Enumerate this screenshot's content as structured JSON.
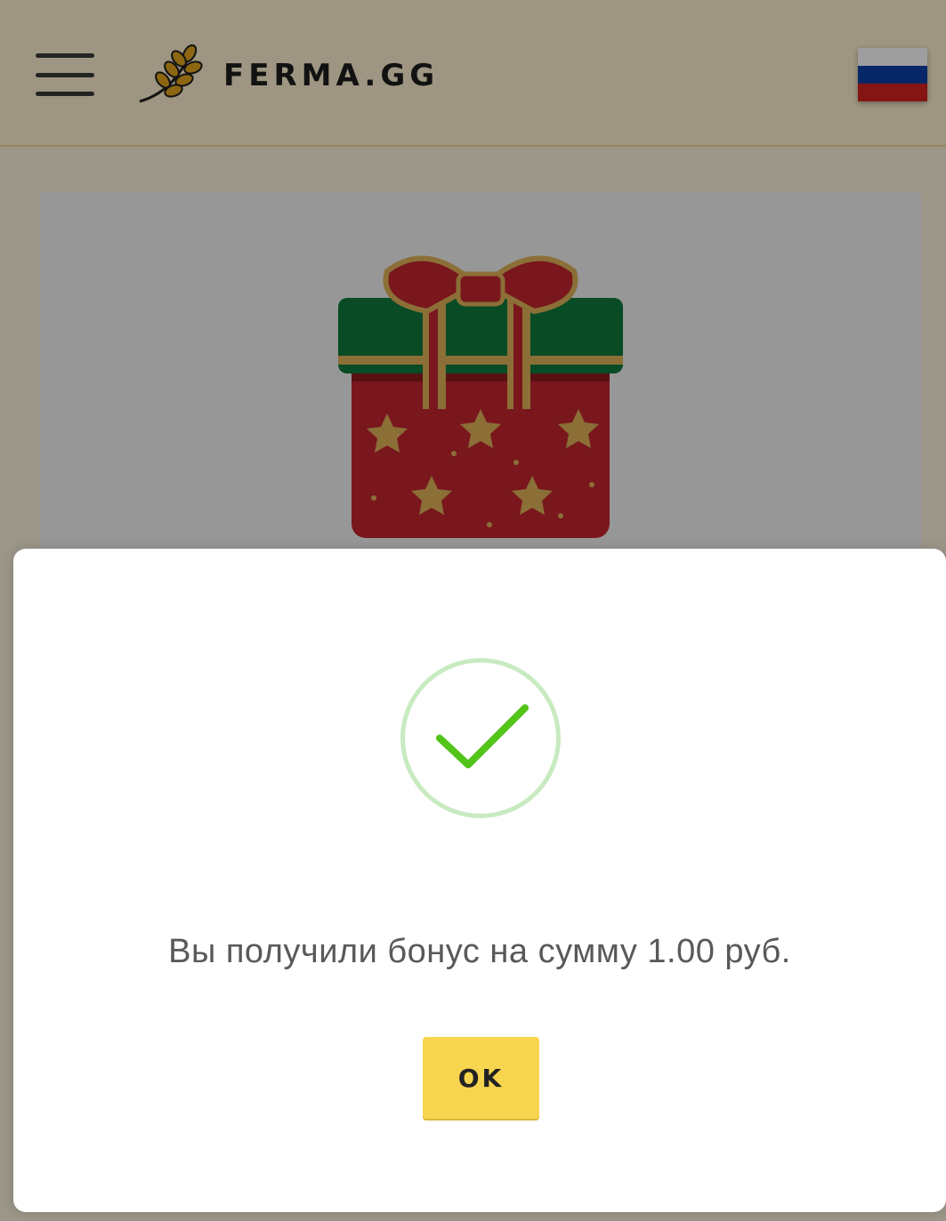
{
  "header": {
    "brand": "FERMA.GG",
    "menu_icon": "hamburger-menu-icon",
    "logo_icon": "wheat-icon",
    "language_flag": "russia-flag-icon",
    "flag_colors": [
      "#ffffff",
      "#0c3fa8",
      "#d5231f"
    ]
  },
  "gift": {
    "icon": "gift-box-icon"
  },
  "modal": {
    "status_icon": "checkmark-icon",
    "message": "Вы получили бонус на сумму 1.00 руб.",
    "ok_label": "OK"
  },
  "colors": {
    "accent": "#f8d54e",
    "success": "#52c41a",
    "header_bg": "#fff3d2"
  }
}
